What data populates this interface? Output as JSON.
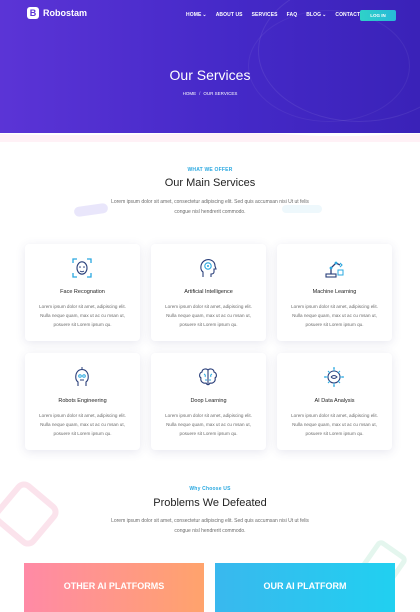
{
  "header": {
    "brand_letter": "B",
    "brand_name": "Robostam",
    "nav": [
      {
        "label": "HOME",
        "dropdown": true
      },
      {
        "label": "ABOUT US",
        "dropdown": false
      },
      {
        "label": "SERVICES",
        "dropdown": false
      },
      {
        "label": "FAQ",
        "dropdown": false
      },
      {
        "label": "BLOG",
        "dropdown": true
      },
      {
        "label": "CONTACT",
        "dropdown": false
      }
    ],
    "login_label": "LOG IN",
    "page_title": "Our Services",
    "breadcrumb": [
      "HOME",
      "OUR SERVICES"
    ]
  },
  "services_section": {
    "eyebrow": "WHAT WE OFFER",
    "title": "Our Main Services",
    "text": "Lorem ipsum dolor sit amet, consectetur adipiscing elit. Sed quis accumsan nisi Ut ut felis congue nisl hendrerit commodo.",
    "cards": [
      {
        "title": "Face Recognation",
        "icon": "face-scan-icon",
        "text": "Lorem ipsum dolor sit amet, adipiscing elit. Nulla neque quam, max ut ac cu msan ut, posuere sit Lorem ipsum qu."
      },
      {
        "title": "Artificial Intelligence",
        "icon": "brain-head-icon",
        "text": "Lorem ipsum dolor sit amet, adipiscing elit. Nulla neque quam, max ut ac cu msan ut, posuere sit Lorem ipsum qu."
      },
      {
        "title": "Machine Learning",
        "icon": "robot-arm-icon",
        "text": "Lorem ipsum dolor sit amet, adipiscing elit. Nulla neque quam, max ut ac cu msan ut, posuere sit Lorem ipsum qu."
      },
      {
        "title": "Robots Engineering",
        "icon": "robot-head-icon",
        "text": "Lorem ipsum dolor sit amet, adipiscing elit. Nulla neque quam, max ut ac cu msan ut, posuere sit Lorem ipsum qu."
      },
      {
        "title": "Doop Learning",
        "icon": "brain-icon",
        "text": "Lorem ipsum dolor sit amet, adipiscing elit. Nulla neque quam, max ut ac cu msan ut, posuere sit Lorem ipsum qu."
      },
      {
        "title": "AI Data Analysis",
        "icon": "data-brain-icon",
        "text": "Lorem ipsum dolor sit amet, adipiscing elit. Nulla neque quam, max ut ac cu msan ut, posuere sit Lorem ipsum qu."
      }
    ]
  },
  "problems_section": {
    "eyebrow": "Why Choose US",
    "title": "Problems We Defeated",
    "text": "Lorem ipsum dolor sit amet, consectetur adipiscing elit. Sed quis accumsan nisi Ut ut felis congue nisl hendrerit commodo.",
    "panels": [
      "OTHER AI PLATFORMS",
      "OUR AI PLATFORM"
    ]
  },
  "colors": {
    "hero_start": "#5b34d6",
    "hero_end": "#3a22b8",
    "accent_blue": "#2aa8e0",
    "login_start": "#2fd2c8",
    "panel_left": "#ff8aa6",
    "panel_right": "#39b8ee"
  }
}
